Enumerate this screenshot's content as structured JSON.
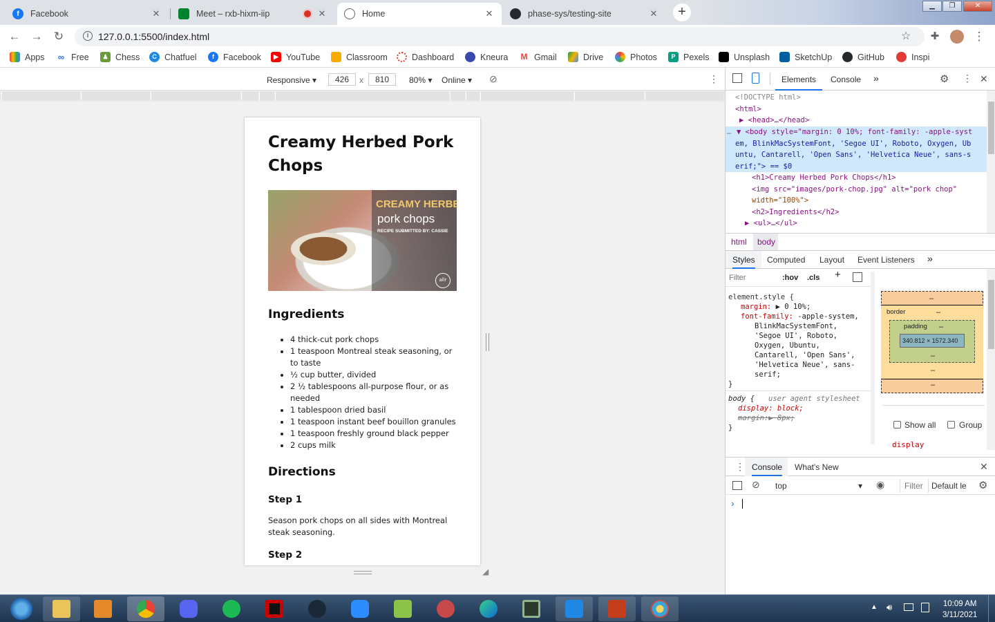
{
  "browser": {
    "tabs": [
      {
        "title": "Facebook",
        "icon": "facebook-icon"
      },
      {
        "title": "Meet – rxb-hixm-iip",
        "icon": "meet-icon"
      },
      {
        "title": "Home",
        "icon": "globe-icon"
      },
      {
        "title": "phase-sys/testing-site",
        "icon": "github-icon"
      }
    ],
    "url": "127.0.0.1:5500/index.html",
    "bookmarks": [
      "Apps",
      "Free",
      "Chess",
      "Chatfuel",
      "Facebook",
      "YouTube",
      "Classroom",
      "Dashboard",
      "Kneura",
      "Gmail",
      "Drive",
      "Photos",
      "Pexels",
      "Unsplash",
      "SketchUp",
      "GitHub",
      "Inspi"
    ]
  },
  "device_toolbar": {
    "mode": "Responsive",
    "width": "426",
    "times": "x",
    "height": "810",
    "zoom": "80%",
    "network": "Online"
  },
  "recipe": {
    "title": "Creamy Herbed Pork Chops",
    "image_text": {
      "line1": "CREAMY HERBED",
      "line2": "pork chops",
      "line3": "RECIPE SUBMITTED BY: CASSIE",
      "badge": "allr"
    },
    "ingredients_heading": "Ingredients",
    "ingredients": [
      "4 thick-cut pork chops",
      "1 teaspoon Montreal steak seasoning, or to taste",
      "½ cup butter, divided",
      "2 ½ tablespoons all-purpose flour, or as needed",
      "1 tablespoon dried basil",
      "1 teaspoon instant beef bouillon granules",
      "1 teaspoon freshly ground black pepper",
      "2 cups milk"
    ],
    "directions_heading": "Directions",
    "step1_heading": "Step 1",
    "step1_text": "Season pork chops on all sides with Montreal steak seasoning.",
    "step2_heading": "Step 2"
  },
  "devtools": {
    "tabs": [
      "Elements",
      "Console"
    ],
    "more": "»",
    "dom": {
      "doctype": "<!DOCTYPE html>",
      "html_open": "<html>",
      "head": "<head>…</head>",
      "body_style_line1": "<body style=\"margin: 0 10%; font-family: -apple-syst",
      "body_style_line2": "em, BlinkMacSystemFont, 'Segoe UI', Roboto, Oxygen, Ub",
      "body_style_line3": "untu, Cantarell, 'Open Sans', 'Helvetica Neue', sans-s",
      "body_style_line4": "erif;\"> == $0",
      "h1": "<h1>Creamy Herbed Pork Chops</h1>",
      "img_line1": "<img src=\"images/pork-chop.jpg\" alt=\"pork chop\"",
      "img_line2": "width=\"100%\">",
      "h2": "<h2>Ingredients</h2>",
      "ul": "<ul>…</ul>"
    },
    "breadcrumbs": [
      "html",
      "body"
    ],
    "style_tabs": [
      "Styles",
      "Computed",
      "Layout",
      "Event Listeners",
      "»"
    ],
    "filter_placeholder": "Filter",
    "hov": ":hov",
    "cls": ".cls",
    "styles": {
      "element_style": "element.style {",
      "margin_prop": "margin:",
      "margin_val": "0 10%;",
      "font_prop": "font-family:",
      "font_val_1": "-apple-system,",
      "font_val_2": "BlinkMacSystemFont,",
      "font_val_3": "'Segoe UI', Roboto,",
      "font_val_4": "Oxygen, Ubuntu,",
      "font_val_5": "Cantarell, 'Open Sans',",
      "font_val_6": "'Helvetica Neue', sans-",
      "font_val_7": "serif;",
      "close": "}",
      "ua_selector": "body {",
      "ua_label": "user agent stylesheet",
      "display": "display: block;",
      "margin_struck": "margin:▶ 8px;",
      "close2": "}"
    },
    "boxmodel": {
      "dash": "–",
      "border_label": "border",
      "padding_label": "padding",
      "content": "340.812 × 1572.340",
      "show_all": "Show all",
      "group": "Group",
      "display_cut": "display"
    },
    "console": {
      "tabs": [
        "Console",
        "What's New"
      ],
      "context": "top",
      "filter": "Filter",
      "levels": "Default le",
      "prompt": "›"
    }
  },
  "taskbar": {
    "time": "10:09 AM",
    "date": "3/11/2021"
  }
}
